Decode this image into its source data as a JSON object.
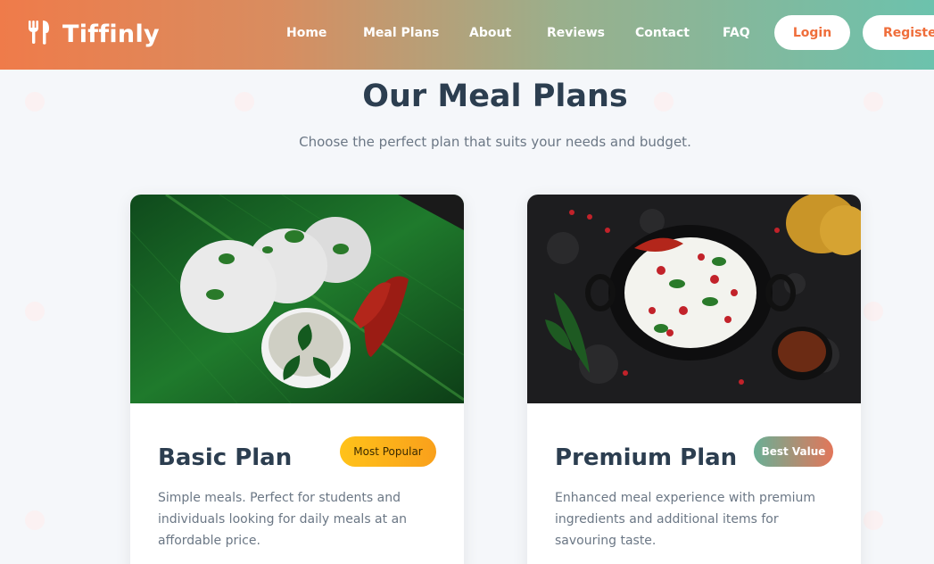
{
  "brand": {
    "name": "Tiffinly",
    "icon": "utensils-icon"
  },
  "nav": {
    "links": [
      "Home",
      "Meal Plans",
      "About",
      "Reviews",
      "Contact",
      "FAQ"
    ],
    "login_label": "Login",
    "register_label": "Register"
  },
  "section": {
    "title": "Our Meal Plans",
    "subtitle": "Choose the perfect plan that suits your needs and budget."
  },
  "plans": [
    {
      "title": "Basic Plan",
      "badge": "Most Popular",
      "description": "Simple meals. Perfect for students and individuals looking for daily meals at an affordable price.",
      "image": "idli-with-coconut-chutney-photo"
    },
    {
      "title": "Premium Plan",
      "badge": "Best Value",
      "description": "Enhanced meal experience with premium ingredients and additional items for savouring taste.",
      "image": "curd-rice-bowl-photo"
    }
  ],
  "colors": {
    "accent_orange": "#ef7b4a",
    "accent_teal": "#6cc2ad",
    "heading": "#2c3e50",
    "muted_text": "#6b7785"
  }
}
